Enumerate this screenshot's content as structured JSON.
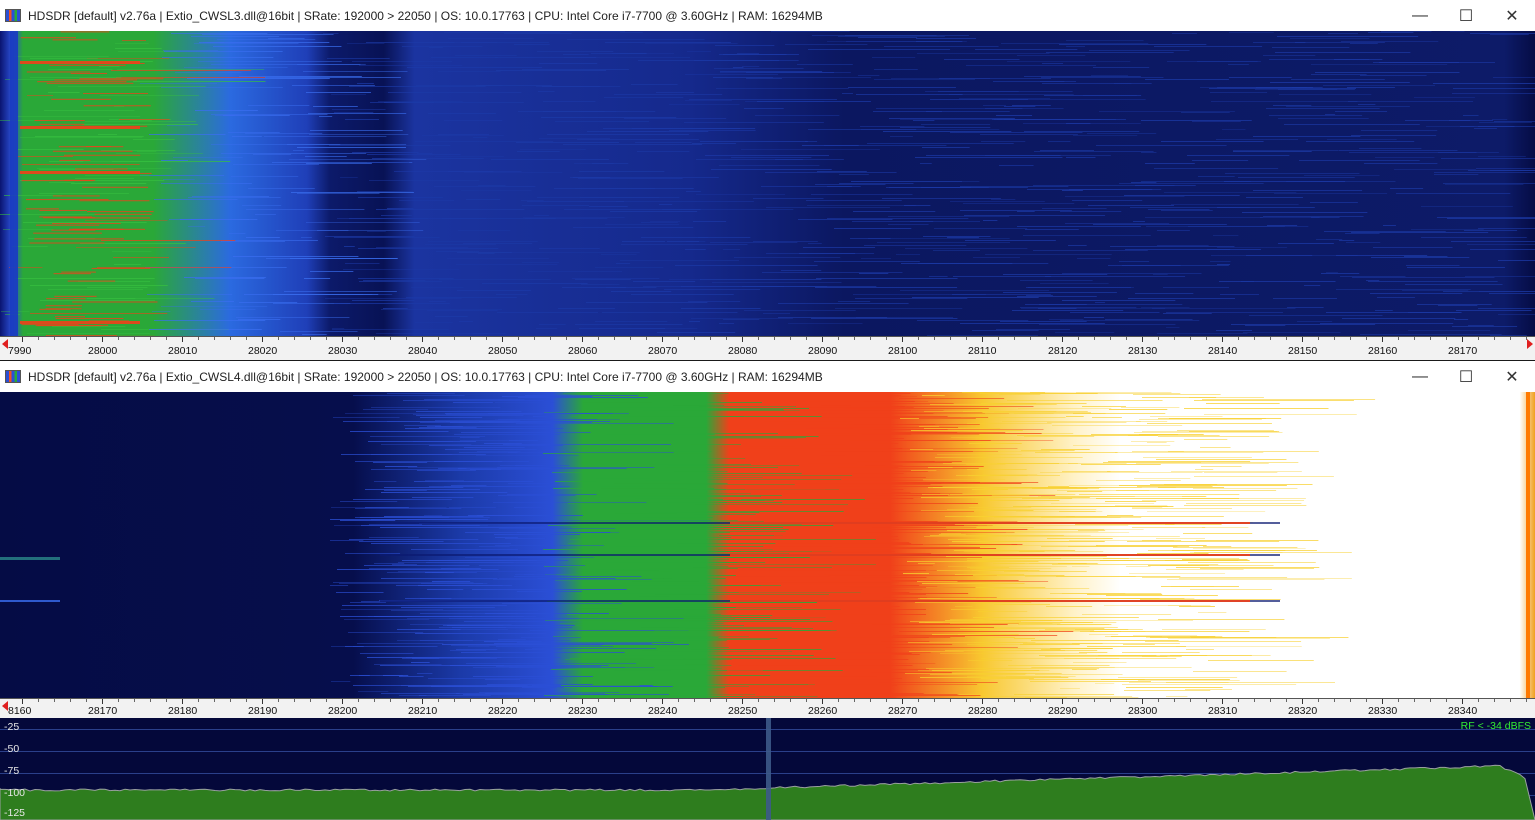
{
  "window1": {
    "title": "HDSDR  [default]  v2.76a  |  Extio_CWSL3.dll@16bit  |  SRate: 192000 > 22050  |  OS: 10.0.17763   |  CPU: Intel Core i7-7700 @ 3.60GHz  |  RAM: 16294MB",
    "controls": {
      "minimize": "—",
      "maximize": "☐",
      "close": "✕"
    },
    "scale_labels": [
      "7990",
      "28000",
      "28010",
      "28020",
      "28030",
      "28040",
      "28050",
      "28060",
      "28070",
      "28080",
      "28090",
      "28100",
      "28110",
      "28120",
      "28130",
      "28140",
      "28150",
      "28160",
      "28170"
    ]
  },
  "window2": {
    "title": "HDSDR  [default]  v2.76a  |  Extio_CWSL4.dll@16bit  |  SRate: 192000 > 22050  |  OS: 10.0.17763   |  CPU: Intel Core i7-7700 @ 3.60GHz  |  RAM: 16294MB",
    "controls": {
      "minimize": "—",
      "maximize": "☐",
      "close": "✕"
    },
    "scale_labels": [
      "8160",
      "28170",
      "28180",
      "28190",
      "28200",
      "28210",
      "28220",
      "28230",
      "28240",
      "28250",
      "28260",
      "28270",
      "28280",
      "28290",
      "28300",
      "28310",
      "28320",
      "28330",
      "28340"
    ],
    "spectrum": {
      "db_labels": [
        "-25",
        "-50",
        "-75",
        "-100",
        "-125"
      ],
      "rf_label": "RF < -34 dBFS"
    }
  },
  "colors": {
    "waterfall_bg": "#050c45",
    "signal_blue": "#2b4fd6",
    "signal_green": "#2aa838",
    "signal_red": "#f0401a",
    "signal_yellow": "#f8d030",
    "signal_white": "#ffffff",
    "spectrum_fill": "#2e7d1e",
    "rf_label": "#33ee33"
  }
}
